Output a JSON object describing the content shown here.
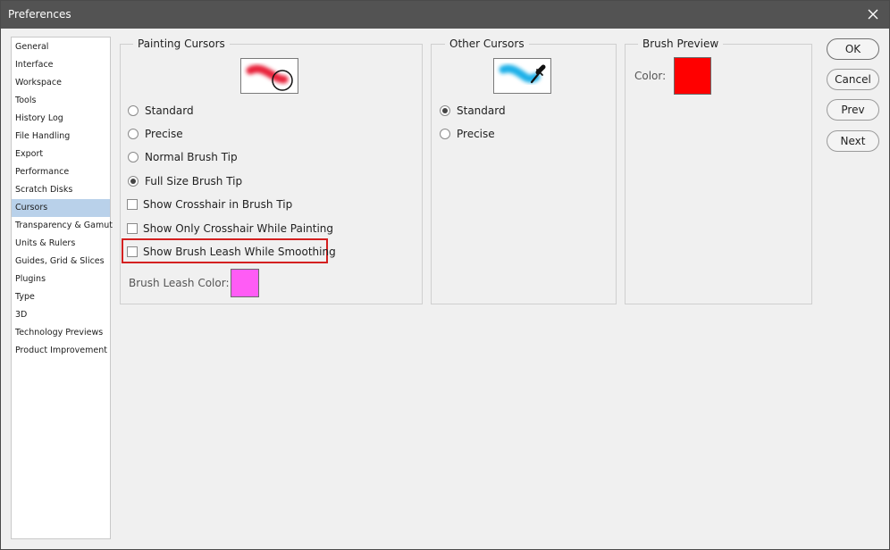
{
  "window": {
    "title": "Preferences"
  },
  "sidebar": {
    "items": [
      {
        "label": "General"
      },
      {
        "label": "Interface"
      },
      {
        "label": "Workspace"
      },
      {
        "label": "Tools"
      },
      {
        "label": "History Log"
      },
      {
        "label": "File Handling"
      },
      {
        "label": "Export"
      },
      {
        "label": "Performance"
      },
      {
        "label": "Scratch Disks"
      },
      {
        "label": "Cursors",
        "selected": true
      },
      {
        "label": "Transparency & Gamut"
      },
      {
        "label": "Units & Rulers"
      },
      {
        "label": "Guides, Grid & Slices"
      },
      {
        "label": "Plugins"
      },
      {
        "label": "Type"
      },
      {
        "label": "3D"
      },
      {
        "label": "Technology Previews"
      },
      {
        "label": "Product Improvement"
      }
    ]
  },
  "painting_cursors": {
    "title": "Painting Cursors",
    "preview_icon": "red-brush-stroke-with-circle-icon",
    "options": [
      {
        "label": "Standard",
        "checked": false
      },
      {
        "label": "Precise",
        "checked": false
      },
      {
        "label": "Normal Brush Tip",
        "checked": false
      },
      {
        "label": "Full Size Brush Tip",
        "checked": true
      }
    ],
    "checkboxes": [
      {
        "label": "Show Crosshair in Brush Tip",
        "checked": false
      },
      {
        "label": "Show Only Crosshair While Painting",
        "checked": false
      },
      {
        "label": "Show Brush Leash While Smoothing",
        "checked": false,
        "highlighted": true
      }
    ],
    "leash_color_label": "Brush Leash Color:",
    "leash_color": "#ff5cf5"
  },
  "other_cursors": {
    "title": "Other Cursors",
    "preview_icon": "eyedropper-cyan-stroke-icon",
    "options": [
      {
        "label": "Standard",
        "checked": true
      },
      {
        "label": "Precise",
        "checked": false
      }
    ]
  },
  "brush_preview": {
    "title": "Brush Preview",
    "color_label": "Color:",
    "color": "#ff0000"
  },
  "buttons": {
    "ok": "OK",
    "cancel": "Cancel",
    "prev": "Prev",
    "next": "Next"
  },
  "colors": {
    "titlebar": "#535353",
    "selection": "#b9d1ea",
    "highlight_border": "#d42020"
  }
}
